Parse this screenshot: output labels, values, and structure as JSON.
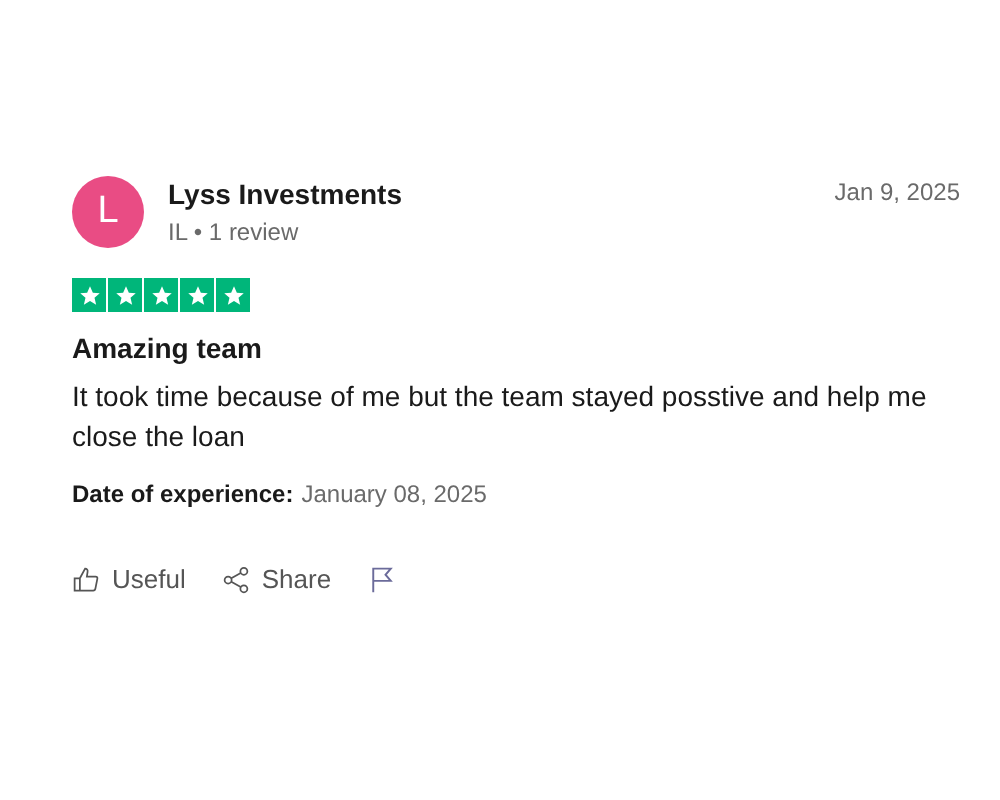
{
  "review": {
    "avatar_letter": "L",
    "author": "Lyss Investments",
    "meta": "IL • 1 review",
    "date": "Jan 9, 2025",
    "stars": 5,
    "title": "Amazing team",
    "body": "It took time because of me but the team stayed posstive and help me close the loan",
    "experience_label": "Date of experience:",
    "experience_date": "January 08, 2025",
    "actions": [
      {
        "kind": "useful",
        "label": "Useful"
      },
      {
        "kind": "share",
        "label": "Share"
      },
      {
        "kind": "flag"
      }
    ]
  }
}
